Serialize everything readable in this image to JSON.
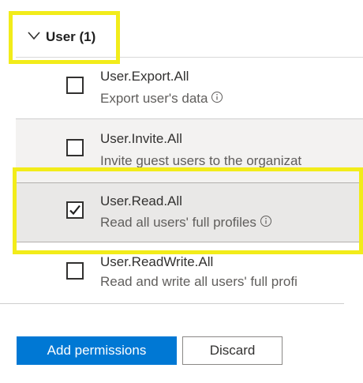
{
  "group": {
    "label": "User (1)",
    "expanded": true
  },
  "permissions": [
    {
      "name": "User.Export.All",
      "description": "Export user's data",
      "checked": false,
      "info_icon": "info-circle-icon"
    },
    {
      "name": "User.Invite.All",
      "description": "Invite guest users to the organizat",
      "checked": false
    },
    {
      "name": "User.Read.All",
      "description": "Read all users' full profiles",
      "checked": true,
      "info_icon": "info-circle-icon"
    },
    {
      "name": "User.ReadWrite.All",
      "description": "Read and write all users' full profi",
      "checked": false
    }
  ],
  "actions": {
    "add_label": "Add permissions",
    "discard_label": "Discard"
  },
  "colors": {
    "primary": "#0078d4",
    "highlight": "#f2ec1a",
    "row_shade": "#f3f2f1"
  }
}
